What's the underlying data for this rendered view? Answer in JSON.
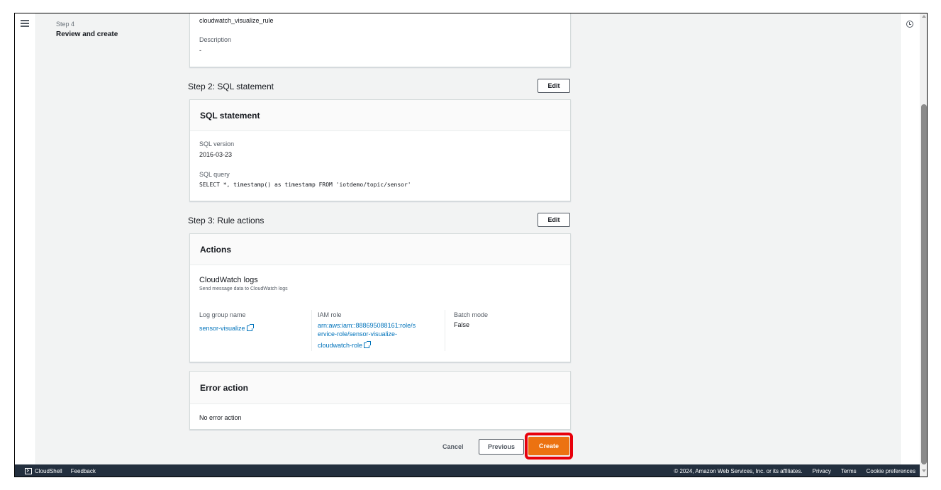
{
  "nav": {
    "step_number": "Step 4",
    "step_title": "Review and create"
  },
  "step1": {
    "rule_name": "cloudwatch_visualize_rule",
    "description_label": "Description",
    "description_value": "-"
  },
  "step2": {
    "title": "Step 2: SQL statement",
    "edit_label": "Edit",
    "card_title": "SQL statement",
    "sql_version_label": "SQL version",
    "sql_version_value": "2016-03-23",
    "sql_query_label": "SQL query",
    "sql_query_value": "SELECT *, timestamp() as timestamp FROM 'iotdemo/topic/sensor'"
  },
  "step3": {
    "title": "Step 3: Rule actions",
    "edit_label": "Edit",
    "actions_title": "Actions",
    "action_name": "CloudWatch logs",
    "action_desc": "Send message data to CloudWatch logs",
    "log_group_label": "Log group name",
    "log_group_value": "sensor-visualize",
    "iam_role_label": "IAM role",
    "iam_role_line1": "arn:aws:iam::888695088161:role/s",
    "iam_role_line2": "ervice-role/sensor-visualize-",
    "iam_role_line3": "cloudwatch-role",
    "batch_mode_label": "Batch mode",
    "batch_mode_value": "False",
    "error_title": "Error action",
    "error_value": "No error action"
  },
  "buttons": {
    "cancel": "Cancel",
    "previous": "Previous",
    "create": "Create"
  },
  "footer": {
    "cloudshell": "CloudShell",
    "feedback": "Feedback",
    "copyright": "© 2024, Amazon Web Services, Inc. or its affiliates.",
    "privacy": "Privacy",
    "terms": "Terms",
    "cookies": "Cookie preferences"
  },
  "colors": {
    "primary_button": "#ec7211",
    "link": "#0073bb",
    "footer_bg": "#232f3e",
    "highlight": "#e8000b"
  }
}
